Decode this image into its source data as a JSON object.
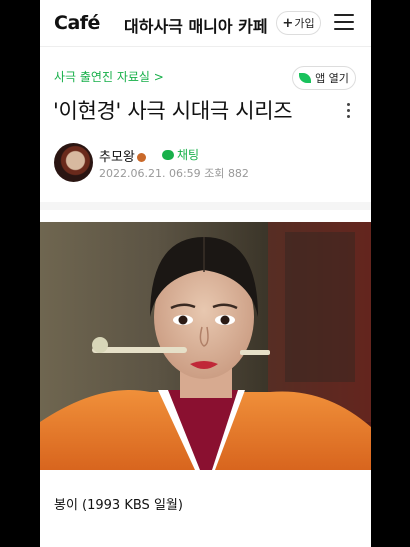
{
  "header": {
    "logo": "Café",
    "cafe_name": "대하사극 매니아 카페",
    "join_label": "가입",
    "join_plus": "+"
  },
  "post": {
    "breadcrumb": "사극 출연진 자료실 >",
    "app_button_label": "앱 열기",
    "title": "'이현경' 사극 시대극 시리즈",
    "author": "추모왕",
    "chat_label": "채팅",
    "date": "2022.06.21. 06:59",
    "views_label": "조회",
    "views": "882",
    "caption": "봉이 (1993 KBS 일월)"
  },
  "colors": {
    "accent_green": "#18b04a",
    "background_outer": "#000000"
  },
  "icons": [
    "menu-icon",
    "more-icon",
    "leaf-icon",
    "chat-icon",
    "badge-icon"
  ]
}
